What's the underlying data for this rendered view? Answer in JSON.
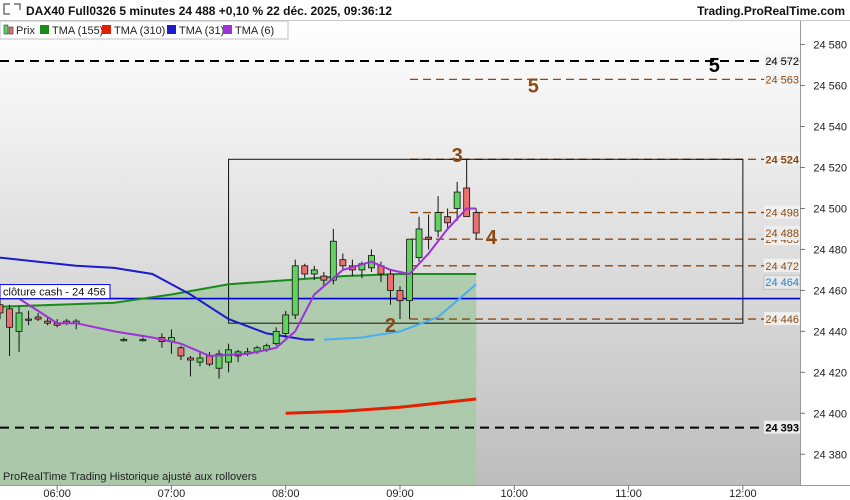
{
  "header": {
    "title": "DAX40 Full0326 5 minutes 24 488 +0,10 % 22 déc. 2025, 09:36:12",
    "brand": "Trading.ProRealTime.com"
  },
  "footer": {
    "note": "ProRealTime Trading  Historique ajusté aux rollovers"
  },
  "cloture_label": "clôture cash -  24 456",
  "colors": {
    "bull": "#5ed35e",
    "bear": "#e87070",
    "tma155": "#1a8a1a",
    "tma310": "#e02000",
    "tma31": "#1c1ccc",
    "tma31_future": "#4aaef0",
    "tma6": "#a030d8",
    "level": "#8b4a14",
    "cash": "#0000dd",
    "fill": "#a7c9a7"
  },
  "chart_data": {
    "type": "candlestick",
    "title": "DAX40 Full0326 5 minutes",
    "legend": [
      {
        "key": "prix",
        "label": "Prix",
        "color": "#5ed35e"
      },
      {
        "key": "tma155",
        "label": "TMA (155)",
        "color": "#1a8a1a"
      },
      {
        "key": "tma310",
        "label": "TMA (310)",
        "color": "#e02000"
      },
      {
        "key": "tma31",
        "label": "TMA (31)",
        "color": "#1c1ccc"
      },
      {
        "key": "tma6",
        "label": "TMA (6)",
        "color": "#a030d8"
      }
    ],
    "y_range": [
      24365,
      24592
    ],
    "y_ticks": [
      {
        "v": 24380,
        "label": "24 380"
      },
      {
        "v": 24400,
        "label": "24 400"
      },
      {
        "v": 24420,
        "label": "24 420"
      },
      {
        "v": 24440,
        "label": "24 440"
      },
      {
        "v": 24460,
        "label": "24 460"
      },
      {
        "v": 24480,
        "label": "24 480"
      },
      {
        "v": 24500,
        "label": "24 500"
      },
      {
        "v": 24520,
        "label": "24 520"
      },
      {
        "v": 24540,
        "label": "24 540"
      },
      {
        "v": 24560,
        "label": "24 560"
      },
      {
        "v": 24580,
        "label": "24 580"
      }
    ],
    "x_range": [
      "05:30",
      "12:30"
    ],
    "x_ticks": [
      {
        "t": "06:00",
        "label": "06:00"
      },
      {
        "t": "07:00",
        "label": "07:00"
      },
      {
        "t": "08:00",
        "label": "08:00"
      },
      {
        "t": "09:00",
        "label": "09:00"
      },
      {
        "t": "10:00",
        "label": "10:00"
      },
      {
        "t": "11:00",
        "label": "11:00"
      },
      {
        "t": "12:00",
        "label": "12:00"
      }
    ],
    "candles": [
      {
        "t": "05:30",
        "o": 24453,
        "h": 24460,
        "l": 24446,
        "c": 24449
      },
      {
        "t": "05:35",
        "o": 24451,
        "h": 24453,
        "l": 24428,
        "c": 24442
      },
      {
        "t": "05:40",
        "o": 24440,
        "h": 24452,
        "l": 24430,
        "c": 24449
      },
      {
        "t": "05:45",
        "o": 24446,
        "h": 24450,
        "l": 24443,
        "c": 24446
      },
      {
        "t": "05:50",
        "o": 24447,
        "h": 24449,
        "l": 24445,
        "c": 24446
      },
      {
        "t": "05:55",
        "o": 24445,
        "h": 24447,
        "l": 24443,
        "c": 24444
      },
      {
        "t": "06:00",
        "o": 24444,
        "h": 24446,
        "l": 24442,
        "c": 24443
      },
      {
        "t": "06:05",
        "o": 24445,
        "h": 24446,
        "l": 24443,
        "c": 24444
      },
      {
        "t": "06:10",
        "o": 24444,
        "h": 24446,
        "l": 24441,
        "c": 24445
      },
      {
        "t": "06:35",
        "o": 24436,
        "h": 24437,
        "l": 24435,
        "c": 24436
      },
      {
        "t": "06:45",
        "o": 24436,
        "h": 24437,
        "l": 24435,
        "c": 24436
      },
      {
        "t": "06:55",
        "o": 24437,
        "h": 24439,
        "l": 24432,
        "c": 24435
      },
      {
        "t": "07:00",
        "o": 24435,
        "h": 24441,
        "l": 24429,
        "c": 24437
      },
      {
        "t": "07:05",
        "o": 24432,
        "h": 24433,
        "l": 24426,
        "c": 24428
      },
      {
        "t": "07:10",
        "o": 24427,
        "h": 24428,
        "l": 24418,
        "c": 24426
      },
      {
        "t": "07:15",
        "o": 24425,
        "h": 24430,
        "l": 24423,
        "c": 24427
      },
      {
        "t": "07:20",
        "o": 24428,
        "h": 24430,
        "l": 24423,
        "c": 24424
      },
      {
        "t": "07:25",
        "o": 24422,
        "h": 24431,
        "l": 24417,
        "c": 24429
      },
      {
        "t": "07:30",
        "o": 24425,
        "h": 24434,
        "l": 24420,
        "c": 24431
      },
      {
        "t": "07:35",
        "o": 24428,
        "h": 24431,
        "l": 24425,
        "c": 24430
      },
      {
        "t": "07:40",
        "o": 24429,
        "h": 24432,
        "l": 24428,
        "c": 24430
      },
      {
        "t": "07:45",
        "o": 24430,
        "h": 24433,
        "l": 24429,
        "c": 24432
      },
      {
        "t": "07:50",
        "o": 24431,
        "h": 24434,
        "l": 24430,
        "c": 24433
      },
      {
        "t": "07:55",
        "o": 24434,
        "h": 24442,
        "l": 24433,
        "c": 24440
      },
      {
        "t": "08:00",
        "o": 24439,
        "h": 24450,
        "l": 24437,
        "c": 24448
      },
      {
        "t": "08:05",
        "o": 24448,
        "h": 24475,
        "l": 24446,
        "c": 24472
      },
      {
        "t": "08:10",
        "o": 24472,
        "h": 24473,
        "l": 24466,
        "c": 24468
      },
      {
        "t": "08:15",
        "o": 24468,
        "h": 24472,
        "l": 24465,
        "c": 24470
      },
      {
        "t": "08:20",
        "o": 24467,
        "h": 24469,
        "l": 24462,
        "c": 24465
      },
      {
        "t": "08:25",
        "o": 24465,
        "h": 24490,
        "l": 24463,
        "c": 24484
      },
      {
        "t": "08:30",
        "o": 24475,
        "h": 24478,
        "l": 24470,
        "c": 24472
      },
      {
        "t": "08:35",
        "o": 24472,
        "h": 24475,
        "l": 24467,
        "c": 24470
      },
      {
        "t": "08:40",
        "o": 24470,
        "h": 24474,
        "l": 24466,
        "c": 24473
      },
      {
        "t": "08:45",
        "o": 24471,
        "h": 24480,
        "l": 24469,
        "c": 24477
      },
      {
        "t": "08:50",
        "o": 24472,
        "h": 24474,
        "l": 24464,
        "c": 24468
      },
      {
        "t": "08:55",
        "o": 24468,
        "h": 24470,
        "l": 24453,
        "c": 24460
      },
      {
        "t": "09:00",
        "o": 24460,
        "h": 24462,
        "l": 24446,
        "c": 24455
      },
      {
        "t": "09:05",
        "o": 24455,
        "h": 24485,
        "l": 24446,
        "c": 24485
      },
      {
        "t": "09:10",
        "o": 24476,
        "h": 24496,
        "l": 24474,
        "c": 24490
      },
      {
        "t": "09:15",
        "o": 24486,
        "h": 24497,
        "l": 24480,
        "c": 24485
      },
      {
        "t": "09:20",
        "o": 24489,
        "h": 24506,
        "l": 24486,
        "c": 24498
      },
      {
        "t": "09:25",
        "o": 24496,
        "h": 24500,
        "l": 24490,
        "c": 24493
      },
      {
        "t": "09:30",
        "o": 24500,
        "h": 24513,
        "l": 24494,
        "c": 24508
      },
      {
        "t": "09:35",
        "o": 24510,
        "h": 24524,
        "l": 24498,
        "c": 24496
      },
      {
        "t": "09:40",
        "o": 24498,
        "h": 24500,
        "l": 24485,
        "c": 24488
      }
    ],
    "tma155": [
      [
        "05:30",
        24452
      ],
      [
        "06:00",
        24453
      ],
      [
        "06:30",
        24454
      ],
      [
        "07:00",
        24458
      ],
      [
        "07:30",
        24463
      ],
      [
        "08:00",
        24465
      ],
      [
        "08:30",
        24467
      ],
      [
        "09:00",
        24468
      ],
      [
        "09:40",
        24468
      ]
    ],
    "tma310": [
      [
        "08:00",
        24400
      ],
      [
        "08:30",
        24401
      ],
      [
        "09:00",
        24403
      ],
      [
        "09:40",
        24407
      ]
    ],
    "tma31": [
      [
        "05:30",
        24476
      ],
      [
        "05:50",
        24474
      ],
      [
        "06:10",
        24472
      ],
      [
        "06:30",
        24471
      ],
      [
        "06:50",
        24468
      ],
      [
        "07:10",
        24458
      ],
      [
        "07:30",
        24446
      ],
      [
        "07:50",
        24439
      ],
      [
        "08:10",
        24436
      ],
      [
        "08:15",
        24436
      ]
    ],
    "tma31_future": [
      [
        "08:20",
        24436
      ],
      [
        "08:40",
        24437
      ],
      [
        "09:00",
        24440
      ],
      [
        "09:20",
        24447
      ],
      [
        "09:40",
        24463
      ]
    ],
    "tma6": [
      [
        "05:30",
        24462
      ],
      [
        "05:40",
        24456
      ],
      [
        "05:50",
        24450
      ],
      [
        "06:00",
        24444
      ],
      [
        "06:10",
        24444
      ],
      [
        "06:30",
        24440
      ],
      [
        "06:50",
        24437
      ],
      [
        "07:05",
        24434
      ],
      [
        "07:20",
        24428
      ],
      [
        "07:40",
        24429
      ],
      [
        "07:55",
        24432
      ],
      [
        "08:05",
        24440
      ],
      [
        "08:15",
        24458
      ],
      [
        "08:30",
        24470
      ],
      [
        "08:45",
        24474
      ],
      [
        "08:55",
        24470
      ],
      [
        "09:05",
        24468
      ],
      [
        "09:15",
        24478
      ],
      [
        "09:25",
        24490
      ],
      [
        "09:35",
        24500
      ],
      [
        "09:40",
        24500
      ]
    ],
    "cloture_cash": 24456,
    "levels": [
      {
        "v": 24572,
        "label": "24 572",
        "style": "black",
        "bold": false
      },
      {
        "v": 24563,
        "label": "24 563",
        "style": "brown",
        "bold": false
      },
      {
        "v": 24524,
        "label": "24 524",
        "style": "brown",
        "bold": true
      },
      {
        "v": 24498,
        "label": "24 498",
        "style": "brown",
        "bold": false
      },
      {
        "v": 24485,
        "label": "24 485",
        "style": "brown",
        "bold": false
      },
      {
        "v": 24472,
        "label": "24 472",
        "style": "brown",
        "bold": false
      },
      {
        "v": 24446,
        "label": "24 446",
        "style": "brown",
        "bold": false
      },
      {
        "v": 24393,
        "label": "24 393",
        "style": "black",
        "bold": true
      }
    ],
    "current_price": {
      "v": 24488,
      "label": "24 488"
    },
    "tma_tag": {
      "v": 24464,
      "label": "24 464"
    },
    "box": {
      "t1": "07:30",
      "t2": "12:00",
      "v1": 24524,
      "v2": 24444
    },
    "wave_labels": [
      {
        "text": "5",
        "t": "11:45",
        "v": 24570,
        "color": "black"
      },
      {
        "text": "5",
        "t": "10:10",
        "v": 24560,
        "color": "brown"
      },
      {
        "text": "3",
        "t": "09:30",
        "v": 24526,
        "color": "brown"
      },
      {
        "text": "4",
        "t": "09:48",
        "v": 24486,
        "color": "brown"
      },
      {
        "text": "2",
        "t": "08:55",
        "v": 24443,
        "color": "brown"
      }
    ]
  }
}
